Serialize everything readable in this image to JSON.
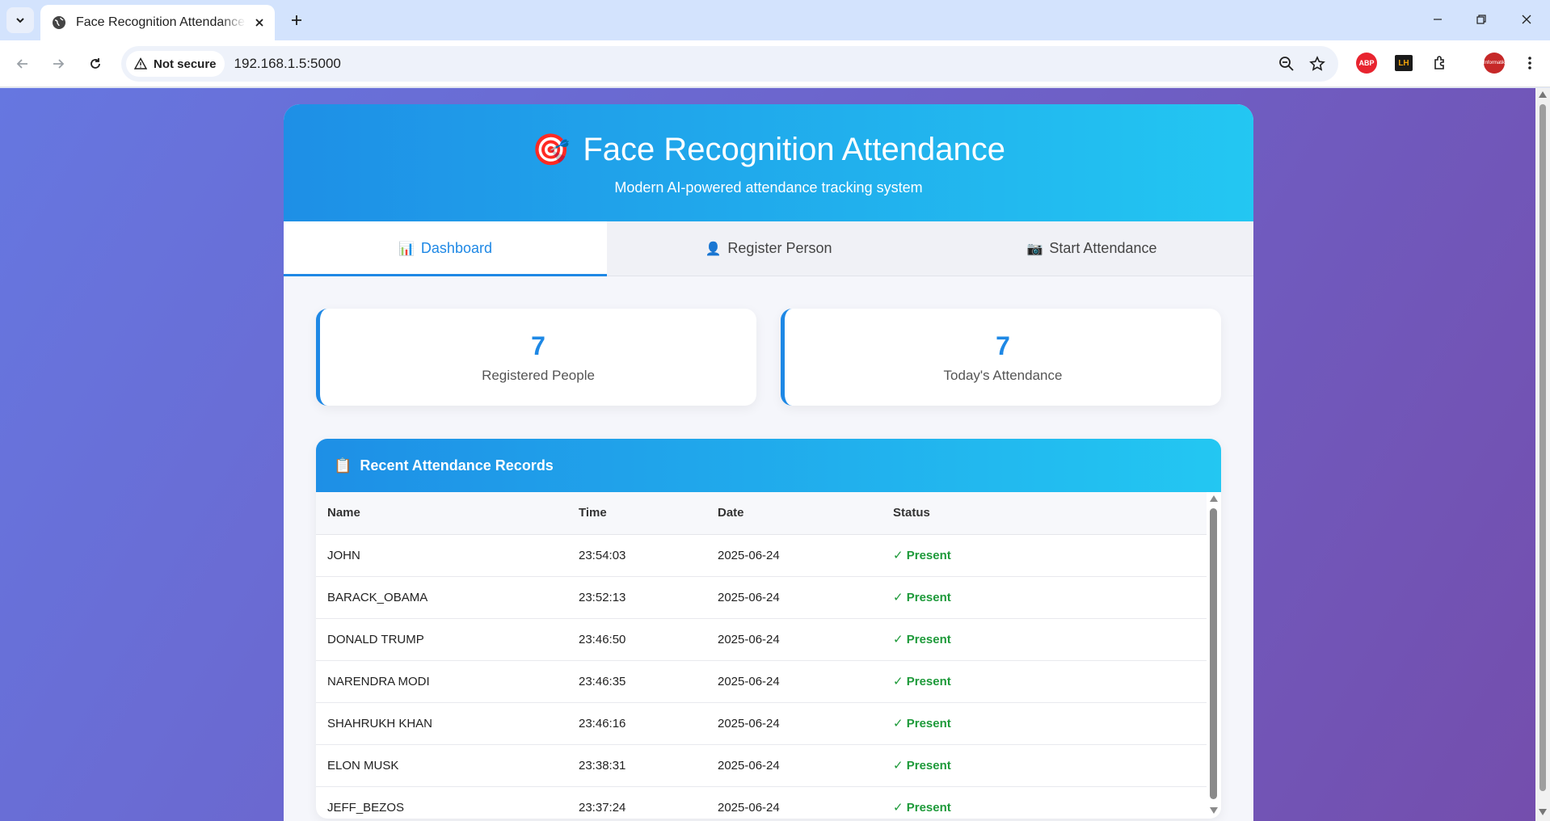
{
  "browser": {
    "tab_title": "Face Recognition Attendance System",
    "security_label": "Not secure",
    "url": "192.168.1.5:5000",
    "extensions": [
      "ABP",
      "LH"
    ],
    "profile_text": "Informatik"
  },
  "colors": {
    "primary": "#1e88e5",
    "gradient_start": "#1e8fe6",
    "gradient_end": "#23c7f2",
    "background_start": "#6677e0",
    "background_end": "#744ead",
    "present": "#1e9a3a"
  },
  "header": {
    "icon": "🎯",
    "title": "Face Recognition Attendance",
    "subtitle": "Modern AI-powered attendance tracking system"
  },
  "nav_tabs": [
    {
      "icon": "📊",
      "label": "Dashboard",
      "active": true
    },
    {
      "icon": "👤",
      "label": "Register Person",
      "active": false
    },
    {
      "icon": "📷",
      "label": "Start Attendance",
      "active": false
    }
  ],
  "stats": [
    {
      "value": "7",
      "label": "Registered People"
    },
    {
      "value": "7",
      "label": "Today's Attendance"
    }
  ],
  "records": {
    "icon": "📋",
    "title": "Recent Attendance Records",
    "columns": [
      "Name",
      "Time",
      "Date",
      "Status"
    ],
    "rows": [
      {
        "name": "JOHN",
        "time": "23:54:03",
        "date": "2025-06-24",
        "status": "✓ Present"
      },
      {
        "name": "BARACK_OBAMA",
        "time": "23:52:13",
        "date": "2025-06-24",
        "status": "✓ Present"
      },
      {
        "name": "DONALD TRUMP",
        "time": "23:46:50",
        "date": "2025-06-24",
        "status": "✓ Present"
      },
      {
        "name": "NARENDRA MODI",
        "time": "23:46:35",
        "date": "2025-06-24",
        "status": "✓ Present"
      },
      {
        "name": "SHAHRUKH KHAN",
        "time": "23:46:16",
        "date": "2025-06-24",
        "status": "✓ Present"
      },
      {
        "name": "ELON MUSK",
        "time": "23:38:31",
        "date": "2025-06-24",
        "status": "✓ Present"
      },
      {
        "name": "JEFF_BEZOS",
        "time": "23:37:24",
        "date": "2025-06-24",
        "status": "✓ Present"
      }
    ]
  }
}
